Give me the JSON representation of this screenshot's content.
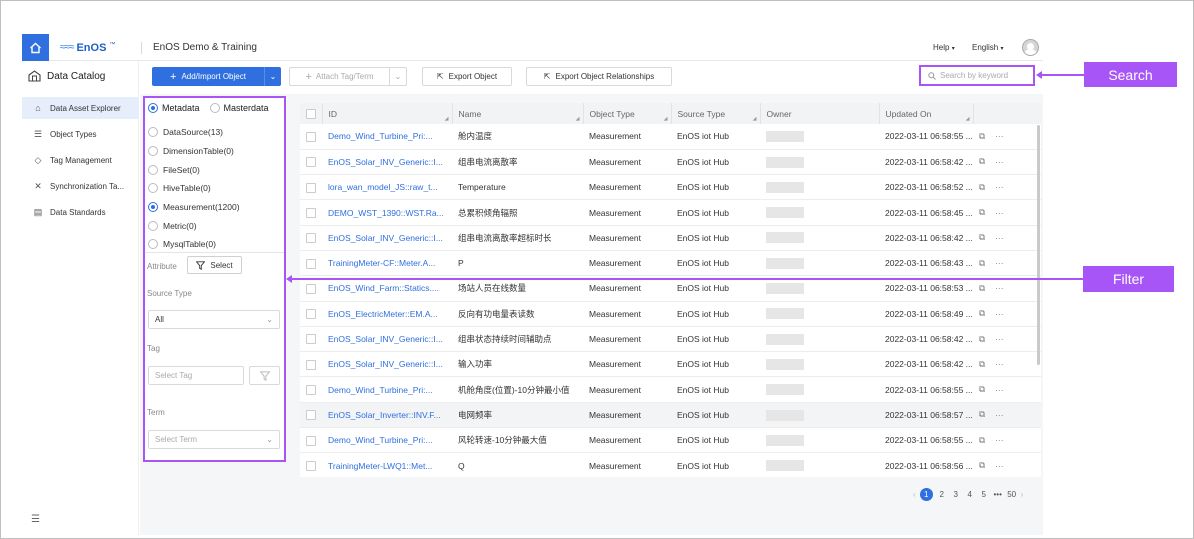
{
  "header": {
    "brand": "EnOS",
    "brand_tm": "™",
    "app_title": "EnOS Demo & Training",
    "help_label": "Help",
    "language_label": "English"
  },
  "sidebar": {
    "title": "Data Catalog",
    "items": [
      {
        "label": "Data Asset Explorer",
        "icon": "asset-explorer-icon",
        "active": true
      },
      {
        "label": "Object Types",
        "icon": "list-icon",
        "active": false
      },
      {
        "label": "Tag Management",
        "icon": "tag-icon",
        "active": false
      },
      {
        "label": "Synchronization Ta...",
        "icon": "sync-icon",
        "active": false
      },
      {
        "label": "Data Standards",
        "icon": "book-icon",
        "active": false
      }
    ]
  },
  "toolbar": {
    "add_import_label": "Add/Import Object",
    "attach_tag_label": "Attach Tag/Term",
    "export_object_label": "Export Object",
    "export_relationships_label": "Export Object Relationships",
    "search_placeholder": "Search by keyword"
  },
  "filter": {
    "scope_options": [
      {
        "label": "Metadata",
        "selected": true
      },
      {
        "label": "Masterdata",
        "selected": false
      }
    ],
    "data_sources": [
      {
        "label": "DataSource(13)",
        "selected": false
      },
      {
        "label": "DimensionTable(0)",
        "selected": false
      },
      {
        "label": "FileSet(0)",
        "selected": false
      },
      {
        "label": "HiveTable(0)",
        "selected": false
      },
      {
        "label": "Measurement(1200)",
        "selected": true
      },
      {
        "label": "Metric(0)",
        "selected": false
      },
      {
        "label": "MysqlTable(0)",
        "selected": false
      }
    ],
    "attribute_label": "Attribute",
    "select_button_label": "Select",
    "source_type_label": "Source Type",
    "source_type_value": "All",
    "tag_label": "Tag",
    "tag_placeholder": "Select Tag",
    "term_label": "Term",
    "term_placeholder": "Select Term"
  },
  "table": {
    "columns": [
      "ID",
      "Name",
      "Object Type",
      "Source Type",
      "Owner",
      "Updated On"
    ],
    "rows": [
      {
        "id": "Demo_Wind_Turbine_Pri:...",
        "name": "舱内温度",
        "object_type": "Measurement",
        "source_type": "EnOS iot Hub",
        "updated": "2022-03-11 06:58:55 ...",
        "highlight": false
      },
      {
        "id": "EnOS_Solar_INV_Generic::I...",
        "name": "组串电流离散率",
        "object_type": "Measurement",
        "source_type": "EnOS iot Hub",
        "updated": "2022-03-11 06:58:42 ...",
        "highlight": false
      },
      {
        "id": "lora_wan_model_JS::raw_t...",
        "name": "Temperature",
        "object_type": "Measurement",
        "source_type": "EnOS iot Hub",
        "updated": "2022-03-11 06:58:52 ...",
        "highlight": false
      },
      {
        "id": "DEMO_WST_1390::WST.Ra...",
        "name": "总累积倾角辐照",
        "object_type": "Measurement",
        "source_type": "EnOS iot Hub",
        "updated": "2022-03-11 06:58:45 ...",
        "highlight": false
      },
      {
        "id": "EnOS_Solar_INV_Generic::I...",
        "name": "组串电流离散率超标时长",
        "object_type": "Measurement",
        "source_type": "EnOS iot Hub",
        "updated": "2022-03-11 06:58:42 ...",
        "highlight": false
      },
      {
        "id": "TrainingMeter-CF::Meter.A...",
        "name": "P",
        "object_type": "Measurement",
        "source_type": "EnOS iot Hub",
        "updated": "2022-03-11 06:58:43 ...",
        "highlight": false
      },
      {
        "id": "EnOS_Wind_Farm::Statics....",
        "name": "场站人员在线数量",
        "object_type": "Measurement",
        "source_type": "EnOS iot Hub",
        "updated": "2022-03-11 06:58:53 ...",
        "highlight": false
      },
      {
        "id": "EnOS_ElectricMeter::EM.A...",
        "name": "反向有功电量表读数",
        "object_type": "Measurement",
        "source_type": "EnOS iot Hub",
        "updated": "2022-03-11 06:58:49 ...",
        "highlight": false
      },
      {
        "id": "EnOS_Solar_INV_Generic::I...",
        "name": "组串状态持续时间辅助点",
        "object_type": "Measurement",
        "source_type": "EnOS iot Hub",
        "updated": "2022-03-11 06:58:42 ...",
        "highlight": false
      },
      {
        "id": "EnOS_Solar_INV_Generic::I...",
        "name": "输入功率",
        "object_type": "Measurement",
        "source_type": "EnOS iot Hub",
        "updated": "2022-03-11 06:58:42 ...",
        "highlight": false
      },
      {
        "id": "Demo_Wind_Turbine_Pri:...",
        "name": "机舱角度(位置)-10分钟最小值",
        "object_type": "Measurement",
        "source_type": "EnOS iot Hub",
        "updated": "2022-03-11 06:58:55 ...",
        "highlight": false
      },
      {
        "id": "EnOS_Solar_Inverter::INV.F...",
        "name": "电网频率",
        "object_type": "Measurement",
        "source_type": "EnOS iot Hub",
        "updated": "2022-03-11 06:58:57 ...",
        "highlight": true
      },
      {
        "id": "Demo_Wind_Turbine_Pri:...",
        "name": "风轮转速-10分钟最大值",
        "object_type": "Measurement",
        "source_type": "EnOS iot Hub",
        "updated": "2022-03-11 06:58:55 ...",
        "highlight": false
      },
      {
        "id": "TrainingMeter-LWQ1::Met...",
        "name": "Q",
        "object_type": "Measurement",
        "source_type": "EnOS iot Hub",
        "updated": "2022-03-11 06:58:56 ...",
        "highlight": false
      }
    ],
    "more_label": "···"
  },
  "pagination": {
    "pages": [
      "2",
      "3",
      "4",
      "5"
    ],
    "current": "1",
    "ellipsis": "•••",
    "last": "50"
  },
  "callouts": {
    "search": "Search",
    "filter": "Filter"
  },
  "colors": {
    "primary": "#2f6fdf",
    "annotation": "#a855f7"
  }
}
